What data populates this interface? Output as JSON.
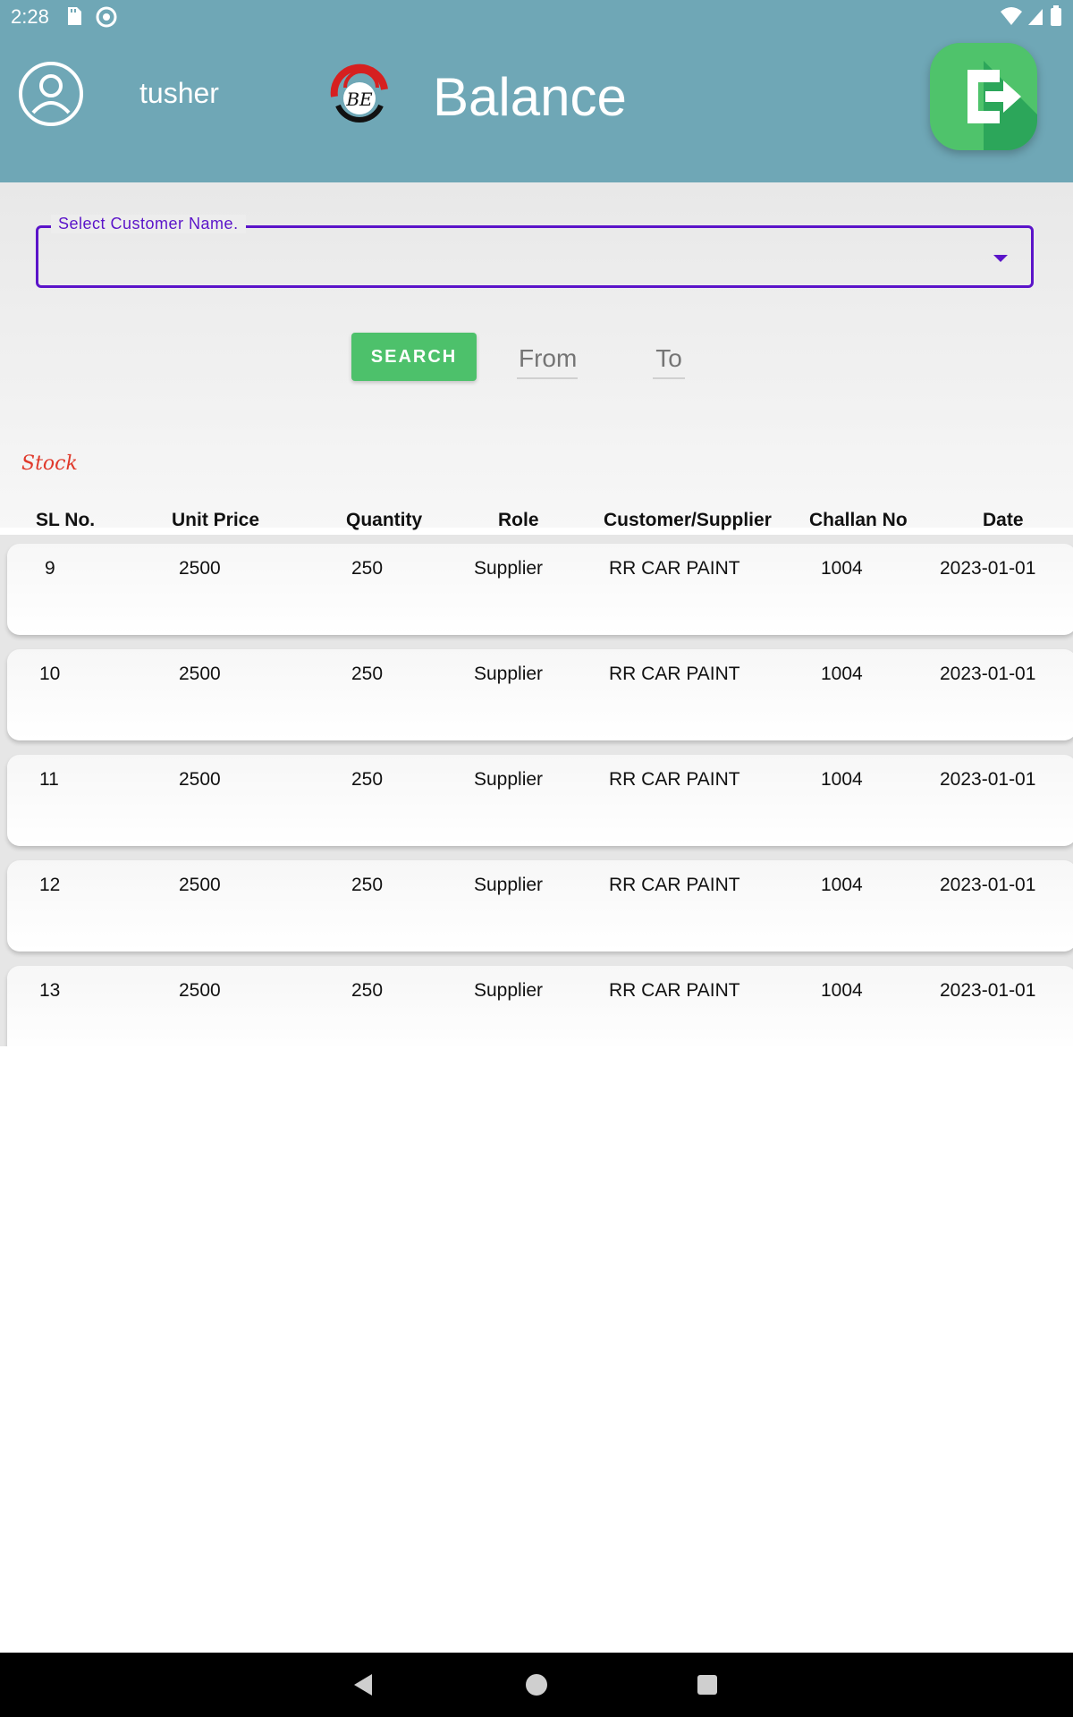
{
  "status_bar": {
    "time": "2:28",
    "icons": [
      "sd-card-icon",
      "data-saver-icon",
      "wifi-icon",
      "signal-icon",
      "battery-icon"
    ]
  },
  "header": {
    "username": "tusher",
    "logo_text": "BE",
    "title": "Balance",
    "background_color": "#6fa7b6",
    "logout_icon": "logout-icon"
  },
  "filter": {
    "customer_label": "Select Customer Name.",
    "search_label": "SEARCH",
    "from_placeholder": "From",
    "to_placeholder": "To",
    "accent_color": "#5b14c9",
    "button_color": "#4dc16b"
  },
  "section_label": "Stock",
  "table": {
    "columns": [
      "SL No.",
      "Unit Price",
      "Quantity",
      "Role",
      "Customer/Supplier",
      "Challan No",
      "Date"
    ],
    "rows": [
      [
        "9",
        "2500",
        "250",
        "Supplier",
        "RR CAR PAINT",
        "1004",
        "2023-01-01"
      ],
      [
        "10",
        "2500",
        "250",
        "Supplier",
        "RR CAR PAINT",
        "1004",
        "2023-01-01"
      ],
      [
        "11",
        "2500",
        "250",
        "Supplier",
        "RR CAR PAINT",
        "1004",
        "2023-01-01"
      ],
      [
        "12",
        "2500",
        "250",
        "Supplier",
        "RR CAR PAINT",
        "1004",
        "2023-01-01"
      ],
      [
        "13",
        "2500",
        "250",
        "Supplier",
        "RR CAR PAINT",
        "1004",
        "2023-01-01"
      ]
    ]
  },
  "nav_bar": {
    "icons": [
      "back-icon",
      "home-icon",
      "recents-icon"
    ]
  }
}
